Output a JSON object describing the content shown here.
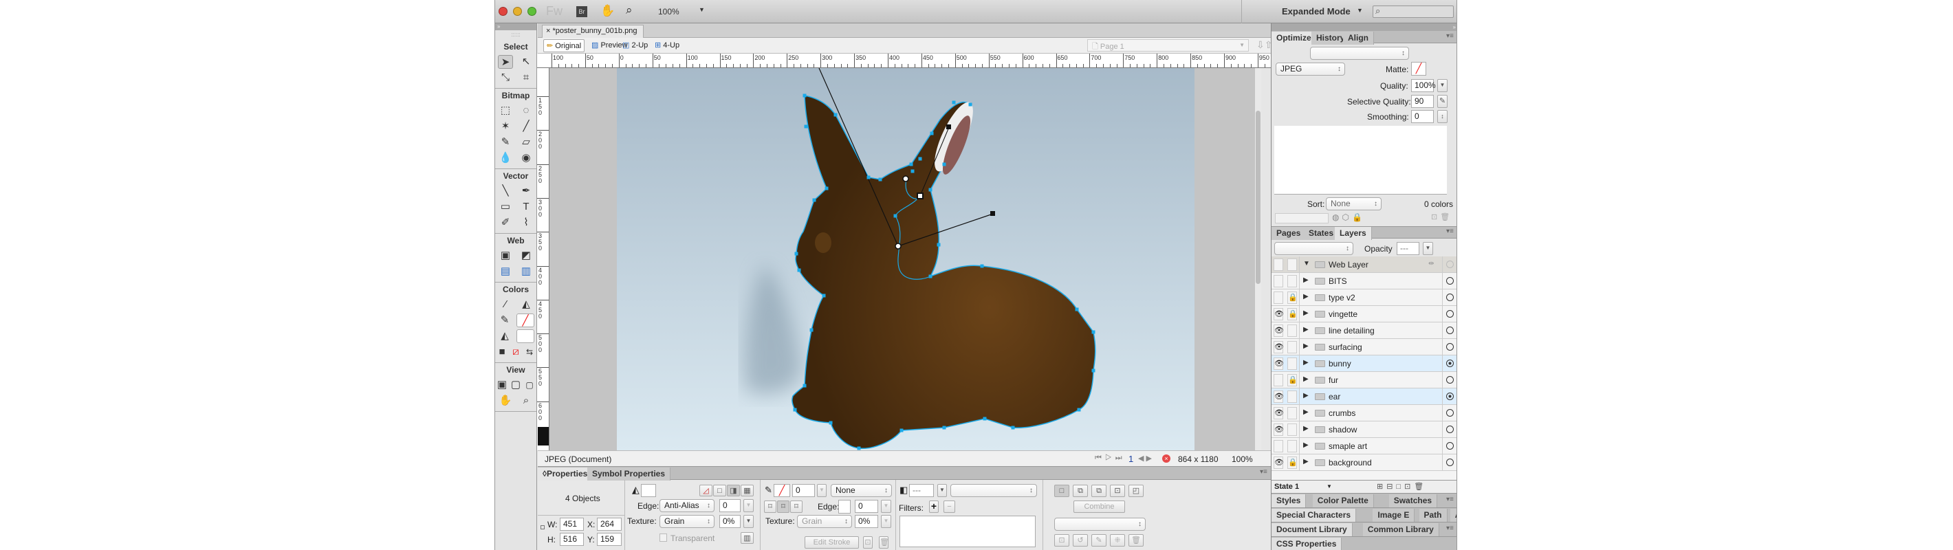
{
  "app": {
    "logo": "Fw",
    "bridge": "Br",
    "zoom": "100%",
    "mode": "Expanded Mode",
    "search_placeholder": ""
  },
  "document": {
    "tab_title": "*poster_bunny_001b.png",
    "close": "×",
    "view_tabs": [
      {
        "label": "Original",
        "active": true
      },
      {
        "label": "Preview"
      },
      {
        "label": "2-Up"
      },
      {
        "label": "4-Up"
      }
    ],
    "page": "Page 1",
    "ruler_top": [
      "100",
      "50",
      "0",
      "50",
      "100",
      "150",
      "200",
      "250",
      "300",
      "350",
      "400",
      "450",
      "500",
      "550",
      "600",
      "650",
      "700",
      "750",
      "800",
      "850",
      "900",
      "950"
    ],
    "ruler_left": [
      "150",
      "200",
      "250",
      "300",
      "350",
      "400",
      "450",
      "500",
      "550",
      "600"
    ],
    "canvas_colors": {
      "bg_top": "#a7bac9",
      "bg_bottom": "#dbe9f1",
      "chocolate": "#4a2e10",
      "selection": "#1aa9e8"
    }
  },
  "status": {
    "doc_type": "JPEG (Document)",
    "frame": "1",
    "size": "864 x 1180",
    "zoom": "100%"
  },
  "tools": {
    "groups": [
      {
        "label": "Select",
        "rows": [
          [
            "pointer",
            "subselect"
          ],
          [
            "scale",
            "crop"
          ]
        ]
      },
      {
        "label": "Bitmap",
        "rows": [
          [
            "marquee",
            "lasso"
          ],
          [
            "magic-wand",
            "brush"
          ],
          [
            "pencil",
            "eraser"
          ],
          [
            "blur",
            "red-eye"
          ]
        ]
      },
      {
        "label": "Vector",
        "rows": [
          [
            "line",
            "pen"
          ],
          [
            "rectangle",
            "text"
          ],
          [
            "freeform",
            "knife"
          ]
        ]
      },
      {
        "label": "Web",
        "rows": [
          [
            "hotspot",
            "slice"
          ],
          [
            "hide-slices",
            "show-slices"
          ]
        ]
      },
      {
        "label": "Colors",
        "rows": [
          [
            "eyedropper",
            "paint-bucket"
          ],
          [
            "stroke-color",
            "stroke-swatch"
          ],
          [
            "fill-color",
            "fill-swatch"
          ],
          [
            "default-colors",
            "no-color",
            "swap-colors"
          ]
        ]
      },
      {
        "label": "View",
        "rows": [
          [
            "standard-mode",
            "full-menu-mode",
            "full-mode"
          ],
          [
            "hand",
            "zoom"
          ]
        ]
      }
    ]
  },
  "properties": {
    "tabs": [
      "Properties",
      "Symbol Properties"
    ],
    "summary": "4 Objects",
    "w_label": "W:",
    "w": "451",
    "x_label": "X:",
    "x": "264",
    "h_label": "H:",
    "h": "516",
    "y_label": "Y:",
    "y": "159",
    "fill": {
      "edge_label": "Edge:",
      "edge": "Anti-Alias",
      "edge_value": "0",
      "texture_label": "Texture:",
      "texture": "Grain",
      "texture_value": "0%",
      "transparent": "Transparent"
    },
    "stroke": {
      "size": "0",
      "type": "None",
      "edge_label": "Edge:",
      "edge_value": "0",
      "texture_label": "Texture:",
      "texture": "Grain",
      "texture_value": "0%",
      "edit_stroke": "Edit Stroke"
    },
    "filters": {
      "opacity": "---",
      "label": "Filters:",
      "add": "+",
      "remove": "−"
    },
    "combine": "Combine"
  },
  "optimize": {
    "tabs": [
      "Optimize",
      "History",
      "Align"
    ],
    "format": "JPEG",
    "matte_label": "Matte:",
    "quality_label": "Quality:",
    "quality": "100%",
    "selective_label": "Selective Quality:",
    "selective": "90",
    "smoothing_label": "Smoothing:",
    "smoothing": "0",
    "sort_label": "Sort:",
    "sort": "None",
    "colors": "0 colors"
  },
  "layers_panel": {
    "tabs": [
      "Pages",
      "States",
      "Layers"
    ],
    "opacity_label": "Opacity",
    "opacity": "---",
    "layers": [
      {
        "name": "Web Layer",
        "visible": false,
        "locked": false,
        "web": true
      },
      {
        "name": "BITS",
        "visible": false,
        "locked": false
      },
      {
        "name": "type v2",
        "visible": false,
        "locked": true
      },
      {
        "name": "vingette",
        "visible": true,
        "locked": true
      },
      {
        "name": "line detailing",
        "visible": true,
        "locked": false
      },
      {
        "name": "surfacing",
        "visible": true,
        "locked": false
      },
      {
        "name": "bunny",
        "visible": true,
        "locked": false,
        "selected": true
      },
      {
        "name": "fur",
        "visible": false,
        "locked": true
      },
      {
        "name": "ear",
        "visible": true,
        "locked": false,
        "selected": true
      },
      {
        "name": "crumbs",
        "visible": true,
        "locked": false
      },
      {
        "name": "shadow",
        "visible": true,
        "locked": false
      },
      {
        "name": "smaple art",
        "visible": false,
        "locked": false
      },
      {
        "name": "background",
        "visible": true,
        "locked": true
      }
    ],
    "state": "State 1"
  },
  "bottom_panels": {
    "row1": [
      "Styles",
      "Color Palette",
      "Swatches"
    ],
    "row2": [
      "Special Characters",
      "Image E",
      "Path",
      "Auto Sha"
    ],
    "row3": [
      "Document Library",
      "Common Library"
    ],
    "row4": [
      "CSS Properties"
    ]
  }
}
